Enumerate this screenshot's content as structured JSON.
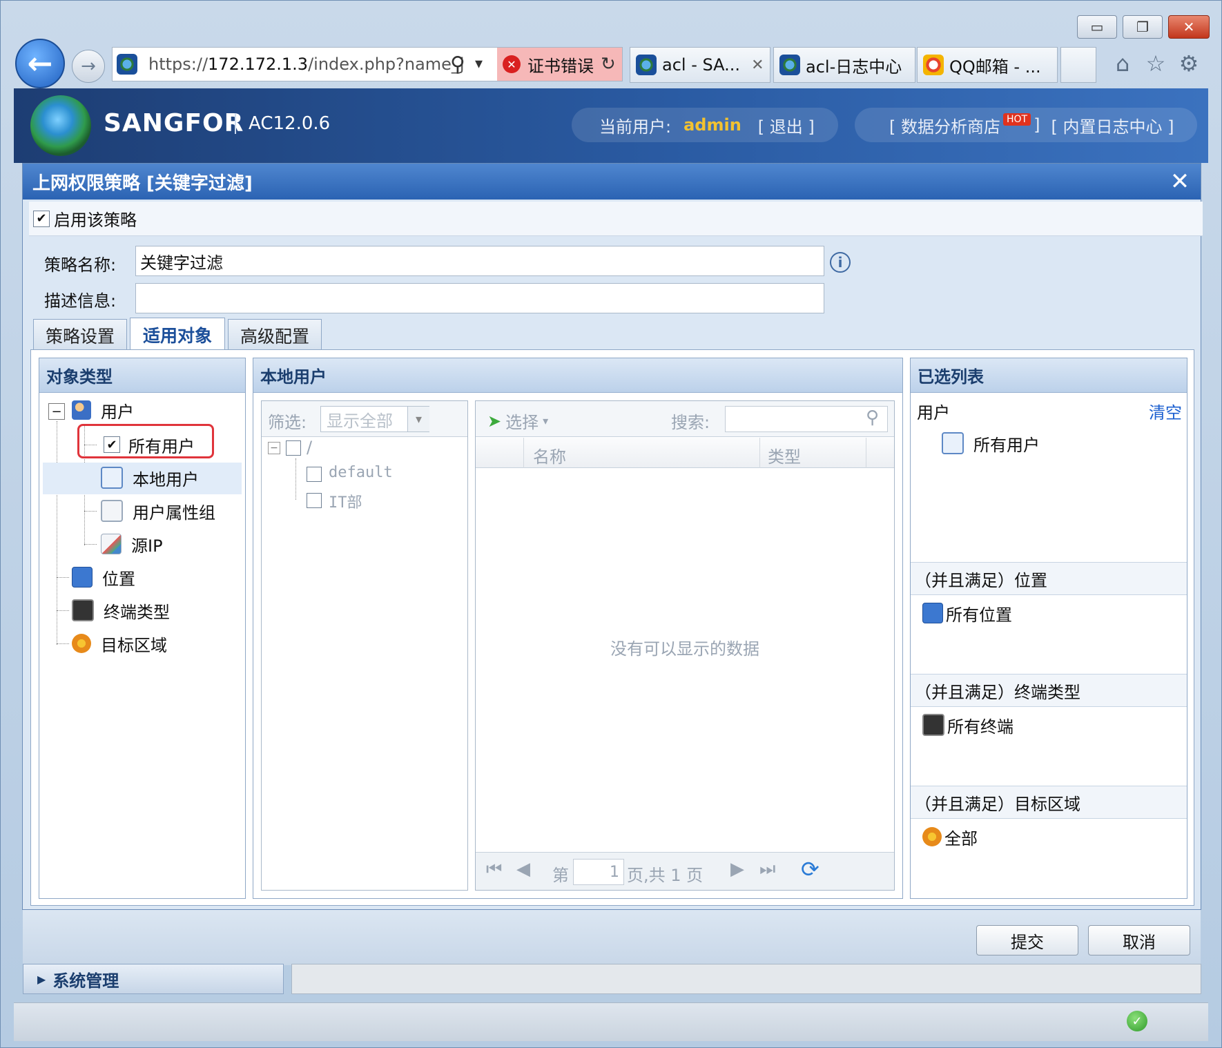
{
  "window": {
    "minimize": "▭",
    "restore": "❐",
    "close": "✕"
  },
  "browser": {
    "back": "←",
    "forward": "→",
    "url_prefix": "https://",
    "url_host": "172.172.1.3",
    "url_rest": "/index.php?name_j",
    "search_icon": "⚲",
    "dropdown": "▾",
    "cert_error": "证书错误",
    "refresh": "↻",
    "tabs": [
      {
        "label": "acl - SA...",
        "close": "✕",
        "icon": "sangfor-icon"
      },
      {
        "label": "acl-日志中心",
        "icon": "sangfor-icon"
      },
      {
        "label": "QQ邮箱 - ...",
        "icon": "qq-mail-icon"
      }
    ],
    "home": "⌂",
    "favorites": "☆",
    "tools": "⚙"
  },
  "app": {
    "brand": "SANGFOR",
    "version": "AC12.0.6",
    "current_user_label": "当前用户:",
    "current_user": "admin",
    "logout": "[ 退出 ]",
    "data_store_pre": "[ 数据分析商店",
    "hot": "HOT",
    "data_store_post": "]",
    "log_center": "[ 内置日志中心 ]",
    "colors": {
      "accent": "#2b63b3",
      "user": "#f2c230",
      "highlight": "#e0343b",
      "link": "#1b5fd0"
    }
  },
  "dialog": {
    "title": "上网权限策略 [关键字过滤]",
    "close": "✕",
    "enable_label": "启用该策略",
    "enabled": true,
    "name_label": "策略名称:",
    "name_value": "关键字过滤",
    "desc_label": "描述信息:",
    "desc_value": "",
    "tabs": [
      "策略设置",
      "适用对象",
      "高级配置"
    ],
    "active_tab": 1,
    "submit": "提交",
    "cancel": "取消"
  },
  "object_types": {
    "title": "对象类型",
    "tree": [
      {
        "label": "用户",
        "expanded": true
      },
      {
        "label": "所有用户",
        "checked": true
      },
      {
        "label": "本地用户",
        "selected": true
      },
      {
        "label": "用户属性组"
      },
      {
        "label": "源IP"
      },
      {
        "label": "位置"
      },
      {
        "label": "终端类型"
      },
      {
        "label": "目标区域"
      }
    ],
    "collapse_symbol": "−"
  },
  "local_users": {
    "title": "本地用户",
    "filter_label": "筛选:",
    "filter_value": "显示全部",
    "tree_root": "/",
    "groups": [
      "default",
      "IT部"
    ],
    "select_btn": "选择",
    "search_label": "搜索:",
    "columns": [
      "名称",
      "类型"
    ],
    "empty_text": "没有可以显示的数据",
    "pager": {
      "page_label": "第",
      "page_value": "1",
      "total_text": "页,共 1 页"
    }
  },
  "selected": {
    "title": "已选列表",
    "user_label": "用户",
    "clear": "清空",
    "user_item": "所有用户",
    "sections": [
      {
        "title": "（并且满足）位置",
        "item": "所有位置"
      },
      {
        "title": "（并且满足）终端类型",
        "item": "所有终端"
      },
      {
        "title": "（并且满足）目标区域",
        "item": "全部"
      }
    ]
  },
  "footer": {
    "system_mgmt": "系统管理"
  }
}
